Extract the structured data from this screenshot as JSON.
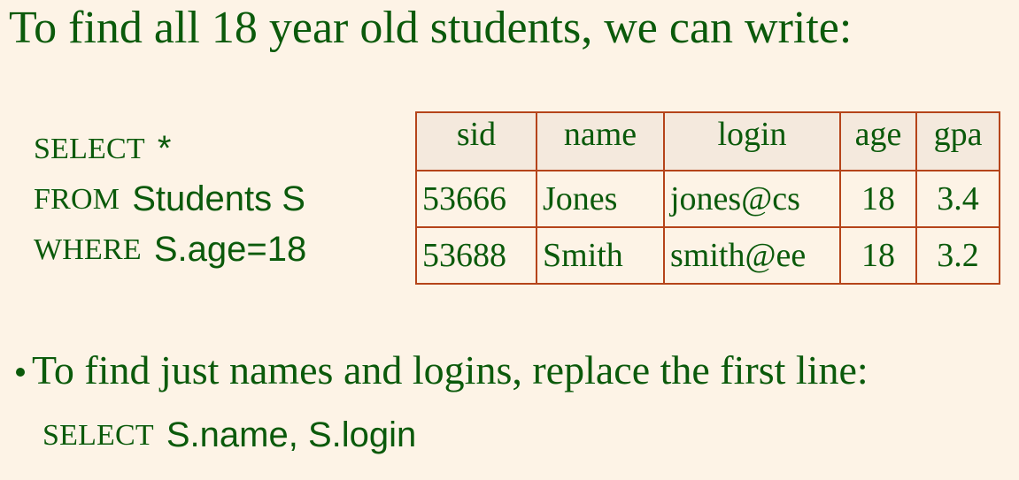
{
  "title": "To find all 18 year old students, we can write:",
  "query": {
    "select_kw": "SELECT",
    "select_arg": "*",
    "from_kw": "FROM",
    "from_arg": "Students S",
    "where_kw": "WHERE",
    "where_arg": "S.age=18"
  },
  "table": {
    "headers": [
      "sid",
      "name",
      "login",
      "age",
      "gpa"
    ],
    "rows": [
      [
        "53666",
        "Jones",
        "jones@cs",
        "18",
        "3.4"
      ],
      [
        "53688",
        "Smith",
        "smith@ee",
        "18",
        "3.2"
      ]
    ]
  },
  "bullet": {
    "text": "To find just names and logins, replace the first line:"
  },
  "replacement": {
    "kw": "SELECT",
    "arg": "S.name, S.login"
  },
  "colors": {
    "background": "#fdf3e6",
    "text": "#0b5a0b",
    "table_border": "#b5441a",
    "header_fill": "#f4e9dd"
  }
}
